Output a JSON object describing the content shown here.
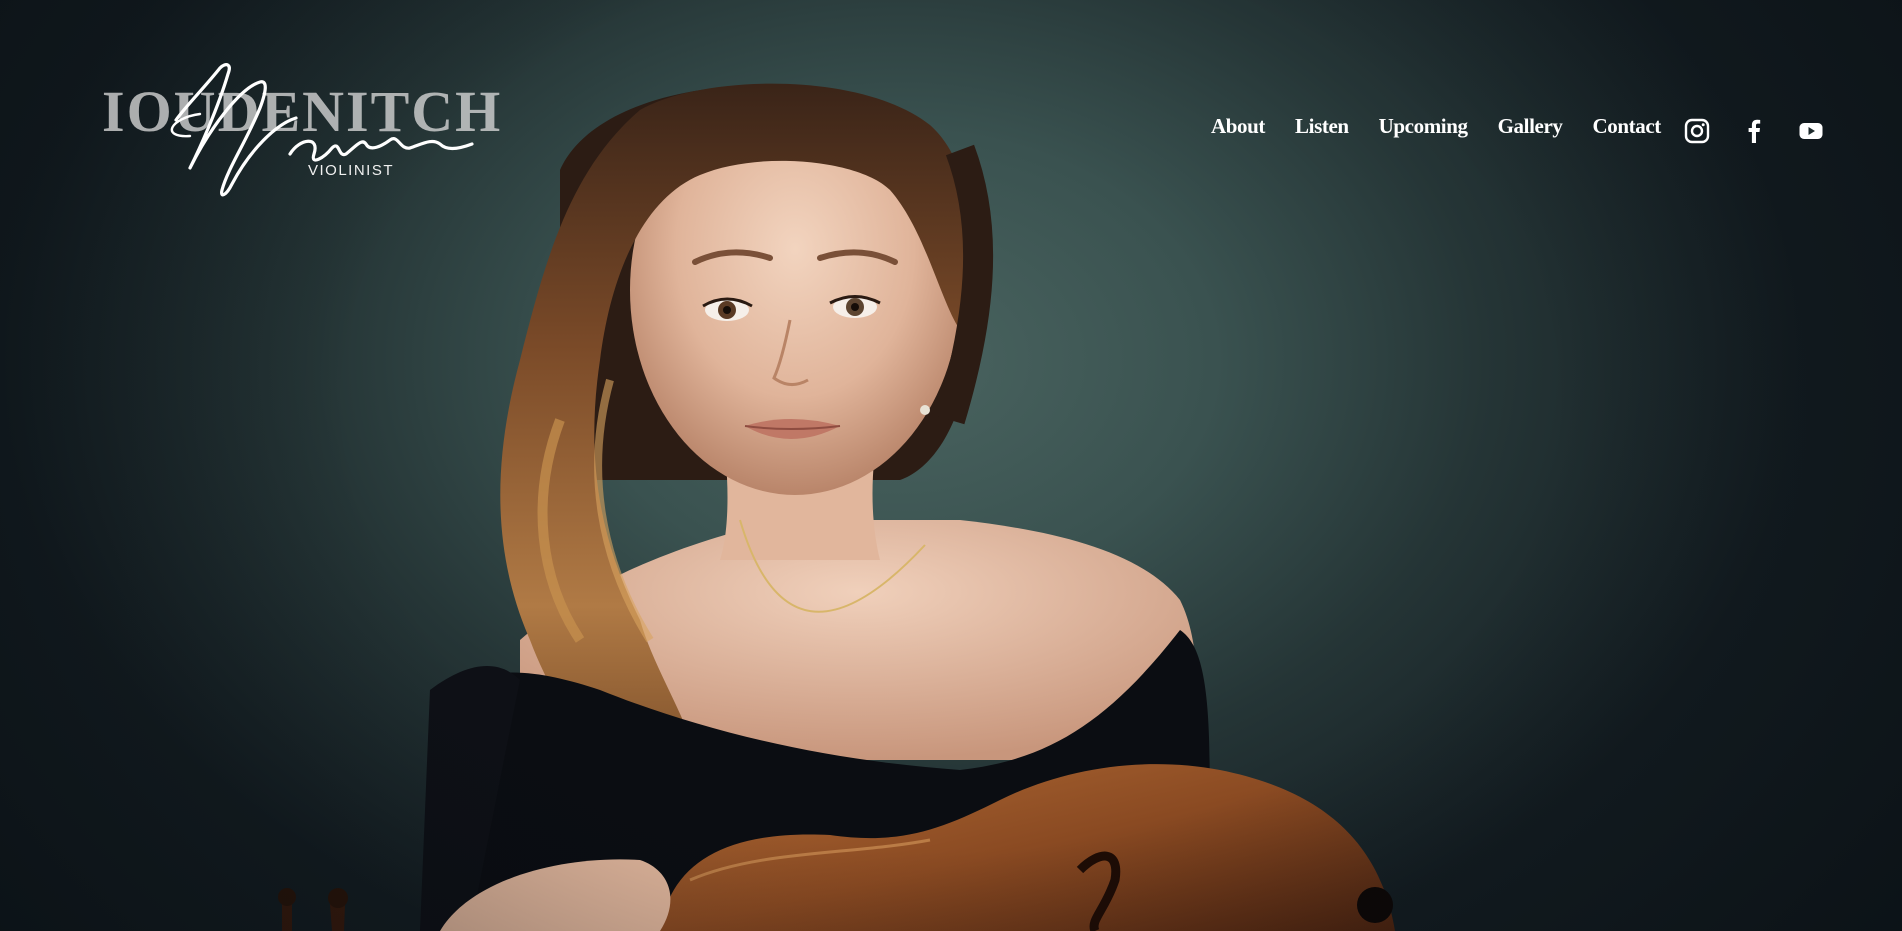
{
  "logo": {
    "surname": "IOUDENITCH",
    "script_name": "Maria",
    "tagline": "VIOLINIST"
  },
  "nav": {
    "items": [
      {
        "label": "About"
      },
      {
        "label": "Listen"
      },
      {
        "label": "Upcoming"
      },
      {
        "label": "Gallery"
      },
      {
        "label": "Contact"
      }
    ]
  },
  "social": {
    "icons": [
      "instagram-icon",
      "facebook-icon",
      "youtube-icon"
    ]
  },
  "colors": {
    "background": "#2e4242",
    "nav_text": "#ffffff",
    "dress": "#0b0d12",
    "violin": "#8a4a22"
  }
}
